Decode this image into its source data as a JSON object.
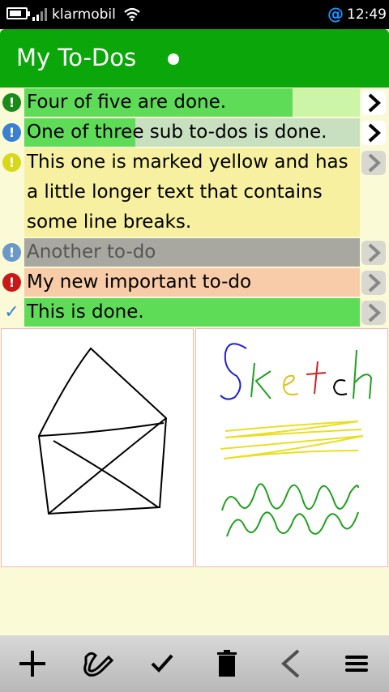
{
  "status_bar": {
    "carrier": "klarmobil",
    "time": "12:49",
    "notification_glyph": "@"
  },
  "header": {
    "title": "My To-Dos"
  },
  "todos": [
    {
      "text": "Four of five are done.",
      "status": "important-done",
      "status_color": "#1a8a1a",
      "bg": "#ccf5a8",
      "progress": 0.8,
      "progress_color": "#5edc58",
      "arrow": "active"
    },
    {
      "text": "One of three sub to-dos is done.",
      "status": "info",
      "status_color": "#3a7fd0",
      "bg": "#c8e0c0",
      "progress": 0.33,
      "progress_color": "#5edc58",
      "arrow": "active"
    },
    {
      "text": "This one is marked yellow and has a little longer text that contains some line breaks.",
      "status": "warning",
      "status_color": "#d8d81a",
      "bg": "#f7f0a0",
      "progress": 0,
      "progress_color": "#f7f0a0",
      "arrow": "inactive"
    },
    {
      "text": "Another to-do",
      "status": "info-grey",
      "status_color": "#6a98c8",
      "bg": "#a8a8a0",
      "progress": 0,
      "progress_color": "#a8a8a0",
      "arrow": "inactive",
      "dimmed": true
    },
    {
      "text": "My new important to-do",
      "status": "important",
      "status_color": "#c81818",
      "bg": "#f8cca8",
      "progress": 0,
      "progress_color": "#f8cca8",
      "arrow": "inactive"
    },
    {
      "text": "This is done.",
      "status": "done",
      "status_color": "#3a80d0",
      "bg": "#5edc58",
      "progress": 1,
      "progress_color": "#5edc58",
      "arrow": "inactive"
    }
  ],
  "sketches": [
    {
      "name": "house-sketch"
    },
    {
      "name": "text-sketch",
      "letters": "Sketch"
    }
  ],
  "toolbar": [
    {
      "name": "add-button",
      "icon": "plus-icon"
    },
    {
      "name": "draw-button",
      "icon": "pen-icon"
    },
    {
      "name": "check-button",
      "icon": "check-icon"
    },
    {
      "name": "delete-button",
      "icon": "trash-icon"
    },
    {
      "name": "back-button",
      "icon": "chevron-left-icon"
    },
    {
      "name": "menu-button",
      "icon": "menu-icon"
    }
  ]
}
